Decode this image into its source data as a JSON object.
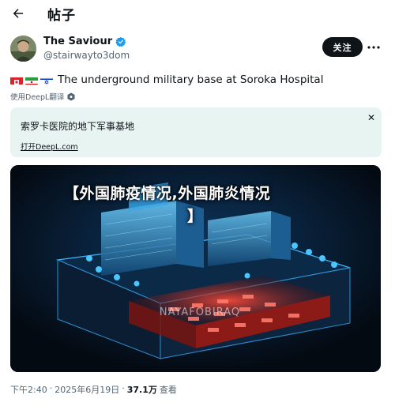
{
  "header": {
    "back_icon": "arrow-left-icon",
    "title": "帖子"
  },
  "author": {
    "name": "The Saviour",
    "handle": "@stairwayto3dom",
    "verified_icon": "verified-badge-icon",
    "verified_color": "#1d9bf0",
    "follow_label": "关注",
    "more_icon": "more-horizontal-icon"
  },
  "tweet": {
    "flags": [
      "flag-icon-red",
      "flag-icon-iran",
      "flag-icon-israel"
    ],
    "text": "The underground military base at Soroka Hospital",
    "translate_label": "使用DeepL翻译",
    "translate_icon": "deepl-icon"
  },
  "translation": {
    "text": "索罗卡医院的地下军事基地",
    "open_label": "打开DeepL.com",
    "close_icon": "close-icon",
    "bg_color": "#e8f4f2"
  },
  "media": {
    "overlay_line1": "【外国肺疫情况,外国肺炎情况",
    "overlay_line2": "】",
    "watermark": "NAYAFOBIRAQ"
  },
  "meta": {
    "time": "下午2:40",
    "dot": "·",
    "date": "2025年6月19日",
    "dot2": "·",
    "views": "37.1万",
    "views_label": "查看"
  }
}
